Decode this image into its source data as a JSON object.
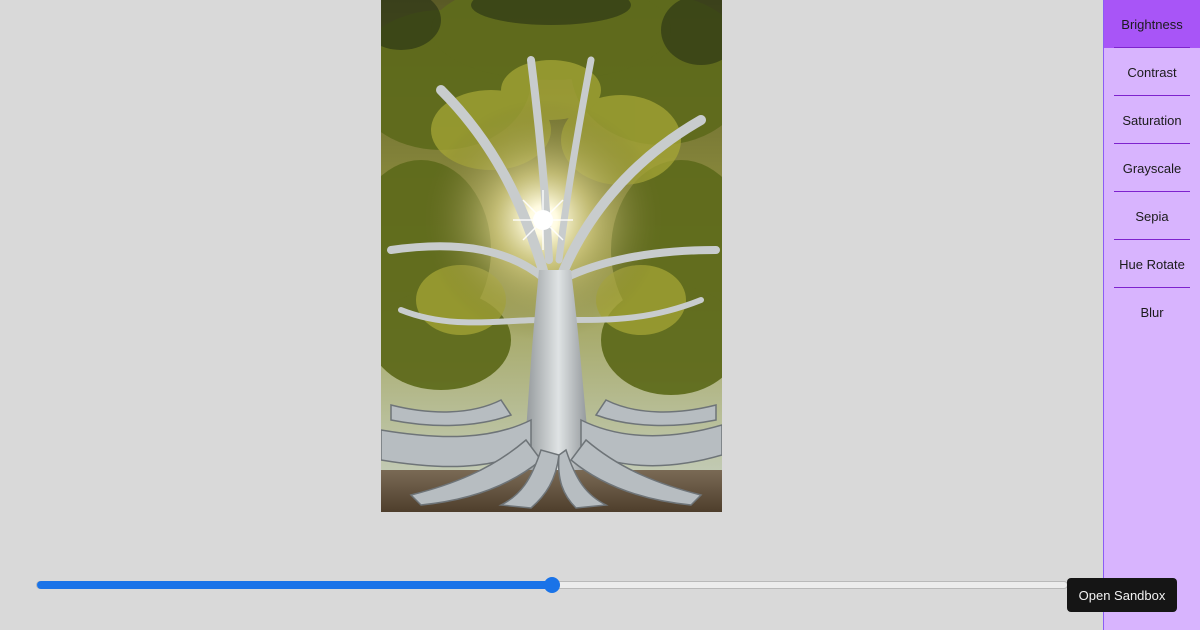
{
  "image": {
    "subject": "tree-photo"
  },
  "sidebar": {
    "items": [
      {
        "label": "Brightness",
        "active": true
      },
      {
        "label": "Contrast",
        "active": false
      },
      {
        "label": "Saturation",
        "active": false
      },
      {
        "label": "Grayscale",
        "active": false
      },
      {
        "label": "Sepia",
        "active": false
      },
      {
        "label": "Hue Rotate",
        "active": false
      },
      {
        "label": "Blur",
        "active": false
      }
    ]
  },
  "slider": {
    "value_fraction": 0.5,
    "accent": "#1a73e8"
  },
  "sandbox": {
    "label": "Open Sandbox"
  },
  "colors": {
    "page_background": "#d9d9d9",
    "sidebar_background": "#d8b4fe",
    "sidebar_active": "#a855f7",
    "divider": "#7e22ce"
  }
}
